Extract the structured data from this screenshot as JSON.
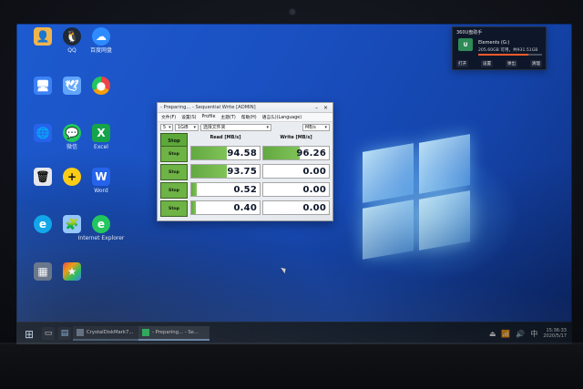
{
  "desktop": {
    "icons": [
      {
        "label": ""
      },
      {
        "label": "QQ"
      },
      {
        "label": "百度网盘"
      },
      {
        "label": ""
      },
      {
        "label": ""
      },
      {
        "label": ""
      },
      {
        "label": ""
      },
      {
        "label": "微信"
      },
      {
        "label": "Excel"
      },
      {
        "label": ""
      },
      {
        "label": ""
      },
      {
        "label": "Word"
      },
      {
        "label": ""
      },
      {
        "label": ""
      },
      {
        "label": "Internet Explorer"
      },
      {
        "label": ""
      },
      {
        "label": ""
      }
    ]
  },
  "notify": {
    "header": "360U盘助手",
    "device_badge": "U",
    "device_name": "Elements (G:)",
    "capacity": "205.60GB 可用，共931.51GB",
    "usage_fraction": 0.78,
    "buttons": [
      "打开",
      "设置",
      "弹出",
      "清理"
    ]
  },
  "cdm": {
    "title": "- Preparing... - Sequential Write [ADMIN]",
    "menu": [
      "文件(F)",
      "设置(S)",
      "Profile",
      "主题(T)",
      "帮助(H)",
      "语言(L)(Language)"
    ],
    "controls": {
      "count": "5",
      "size": "1GiB",
      "target": "选择文件夹",
      "unit": "MB/s"
    },
    "header": {
      "stop_label": "Stop",
      "read_label": "Read [MB/s]",
      "write_label": "Write [MB/s]"
    },
    "rows": [
      {
        "stop": "Stop",
        "read": "94.58",
        "write": "96.26",
        "read_fill": 0.52,
        "write_fill": 0.55
      },
      {
        "stop": "Stop",
        "read": "93.75",
        "write": "0.00",
        "read_fill": 0.52,
        "write_fill": 0.0
      },
      {
        "stop": "Stop",
        "read": "0.52",
        "write": "0.00",
        "read_fill": 0.08,
        "write_fill": 0.0
      },
      {
        "stop": "Stop",
        "read": "0.40",
        "write": "0.00",
        "read_fill": 0.07,
        "write_fill": 0.0
      }
    ]
  },
  "taskbar": {
    "tasks": [
      {
        "label": "CrystalDiskMark7..."
      },
      {
        "label": "- Preparing... - Se..."
      }
    ],
    "time": "15:36:33",
    "date": "2020/5/17"
  }
}
